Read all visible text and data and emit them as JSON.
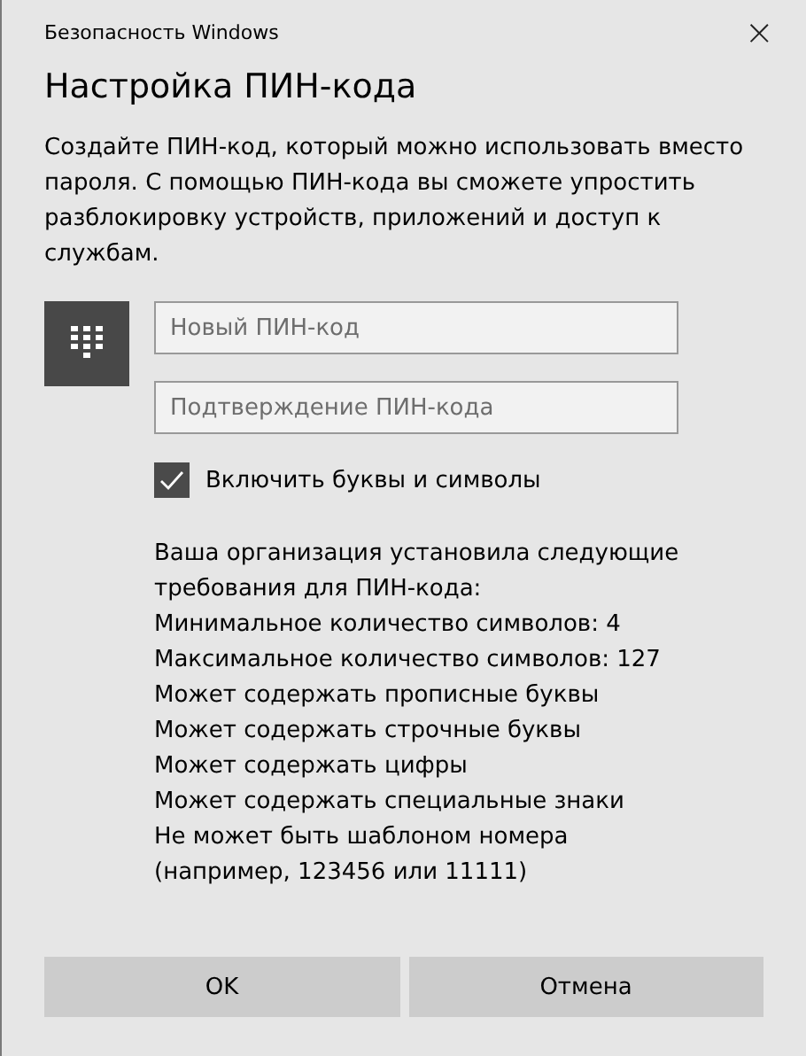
{
  "window": {
    "title": "Безопасность Windows",
    "close": "×"
  },
  "heading": "Настройка ПИН-кода",
  "description": "Создайте ПИН-код, который можно использовать вместо пароля. С помощью ПИН-кода вы сможете упростить разблокировку устройств, приложений и доступ к службам.",
  "fields": [
    {
      "placeholder": "Новый ПИН-код"
    },
    {
      "placeholder": "Подтверждение ПИН-кода"
    }
  ],
  "checkbox": {
    "label": "Включить буквы и символы",
    "checked": true
  },
  "requirements": {
    "intro": "Ваша организация установила следующие требования для ПИН-кода:",
    "items": [
      "Минимальное количество символов: 4",
      "Максимальное количество символов: 127",
      "Может содержать прописные буквы",
      "Может содержать строчные буквы",
      "Может содержать цифры",
      "Может содержать специальные знаки",
      "Не может быть шаблоном номера (например, 123456 или 11111)"
    ]
  },
  "buttons": [
    "OK",
    "Отмена"
  ]
}
